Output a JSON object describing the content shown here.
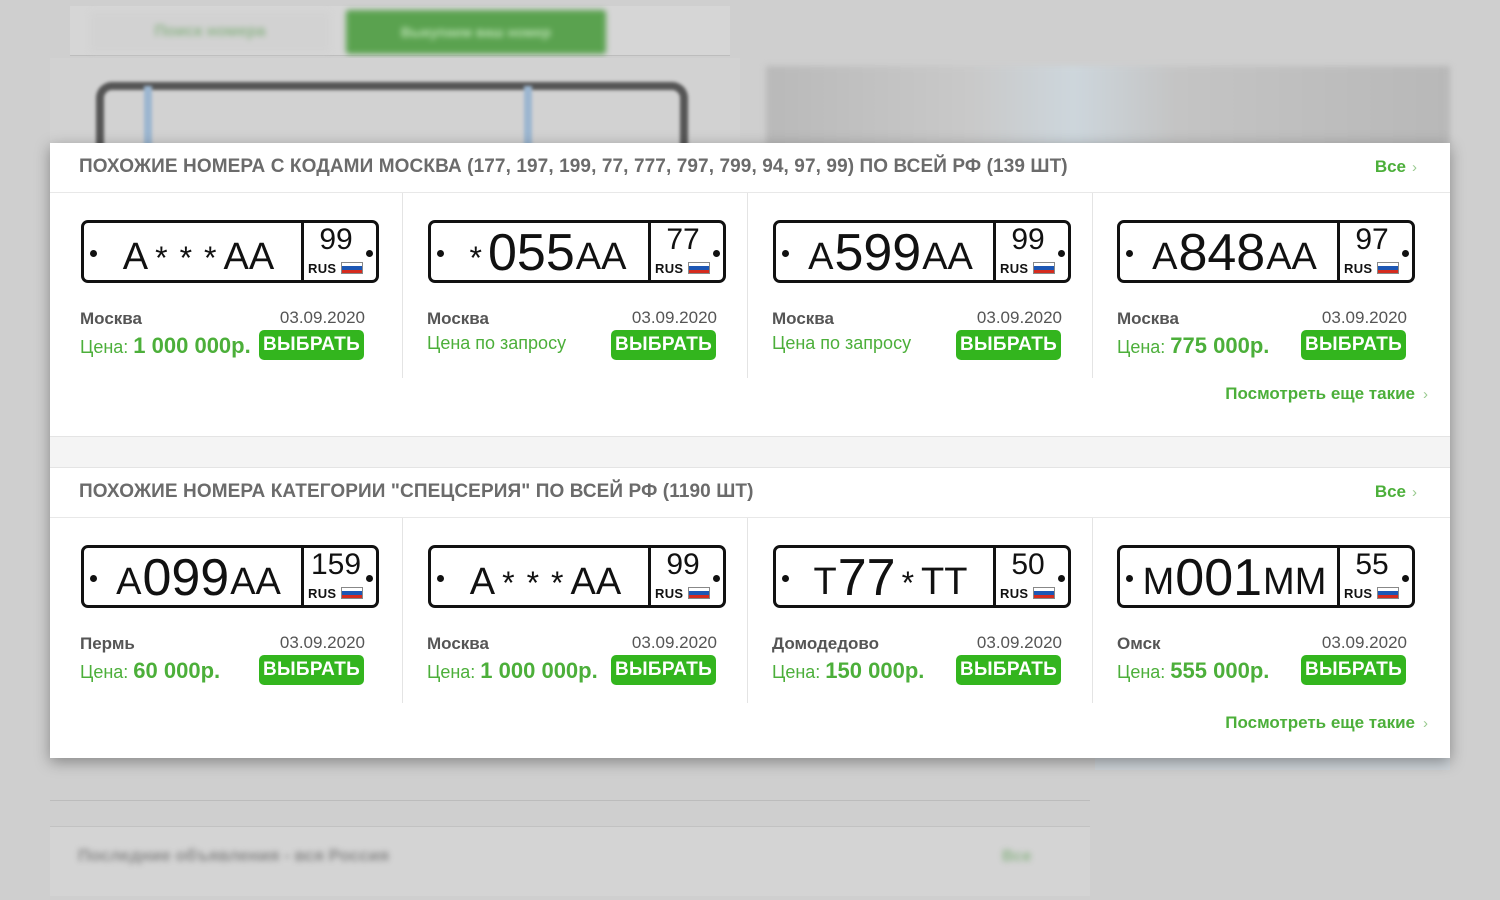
{
  "background": {
    "tab_search": "Поиск номера",
    "tab_sell": "Выкупаем ваш номер",
    "bottom_title": "Последние объявления - вся Россия",
    "bottom_all": "Все"
  },
  "sections": [
    {
      "title": "ПОХОЖИЕ НОМЕРА С КОДАМИ МОСКВА (177, 197, 199, 77, 777, 797, 799, 94, 97, 99) ПО ВСЕЙ РФ (139 ШТ)",
      "all_label": "Все",
      "more_label": "Посмотреть еще такие",
      "cards": [
        {
          "plate": [
            "А",
            "*",
            "*",
            "*",
            "АА"
          ],
          "region": "99",
          "city": "Москва",
          "date": "03.09.2020",
          "price_label": "Цена:",
          "price": "1 000 000р.",
          "button": "ВЫБРАТЬ"
        },
        {
          "plate": [
            "*",
            "055",
            "АА"
          ],
          "region": "77",
          "city": "Москва",
          "date": "03.09.2020",
          "price_label": "Цена по запросу",
          "price": "",
          "button": "ВЫБРАТЬ"
        },
        {
          "plate": [
            "А",
            "599",
            "АА"
          ],
          "region": "99",
          "city": "Москва",
          "date": "03.09.2020",
          "price_label": "Цена по запросу",
          "price": "",
          "button": "ВЫБРАТЬ"
        },
        {
          "plate": [
            "А",
            "848",
            "АА"
          ],
          "region": "97",
          "city": "Москва",
          "date": "03.09.2020",
          "price_label": "Цена:",
          "price": "775 000р.",
          "button": "ВЫБРАТЬ"
        }
      ]
    },
    {
      "title": "ПОХОЖИЕ НОМЕРА КАТЕГОРИИ \"СПЕЦСЕРИЯ\" ПО ВСЕЙ РФ (1190 ШТ)",
      "all_label": "Все",
      "more_label": "Посмотреть еще такие",
      "cards": [
        {
          "plate": [
            "А",
            "099",
            "АА"
          ],
          "region": "159",
          "city": "Пермь",
          "date": "03.09.2020",
          "price_label": "Цена:",
          "price": "60 000р.",
          "button": "ВЫБРАТЬ"
        },
        {
          "plate": [
            "А",
            "*",
            "*",
            "*",
            "АА"
          ],
          "region": "99",
          "city": "Москва",
          "date": "03.09.2020",
          "price_label": "Цена:",
          "price": "1 000 000р.",
          "button": "ВЫБРАТЬ"
        },
        {
          "plate": [
            "Т",
            "77",
            "*",
            "ТТ"
          ],
          "region": "50",
          "city": "Домодедово",
          "date": "03.09.2020",
          "price_label": "Цена:",
          "price": "150 000р.",
          "button": "ВЫБРАТЬ"
        },
        {
          "plate": [
            "М",
            "001",
            "ММ"
          ],
          "region": "55",
          "city": "Омск",
          "date": "03.09.2020",
          "price_label": "Цена:",
          "price": "555 000р.",
          "button": "ВЫБРАТЬ"
        }
      ]
    }
  ],
  "colors": {
    "accent_green": "#4caf3a",
    "button_green": "#33b51e",
    "title_gray": "#6b6b6b"
  }
}
